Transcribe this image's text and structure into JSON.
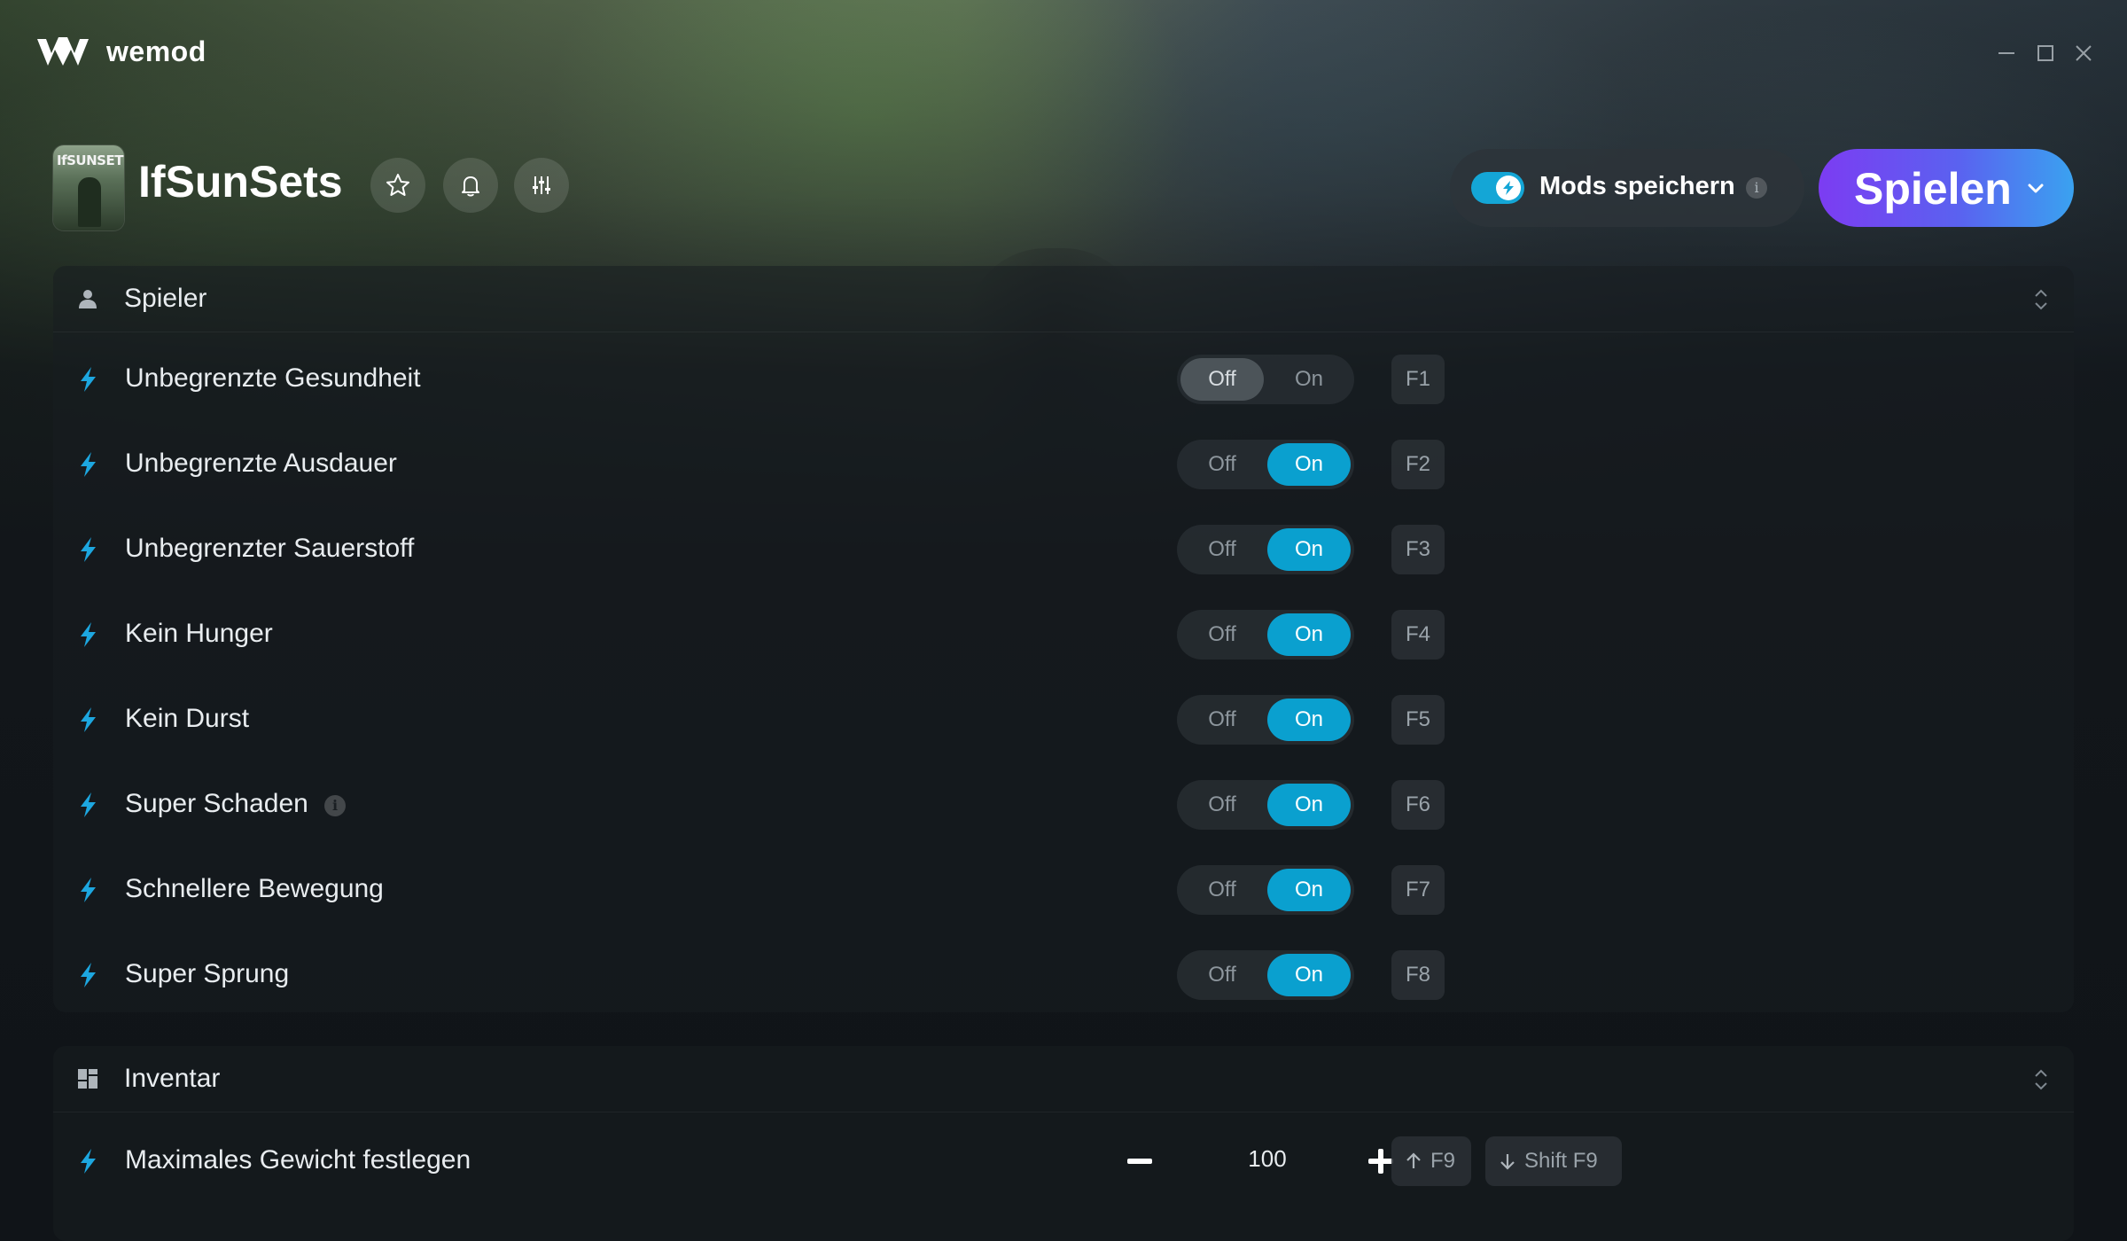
{
  "app": {
    "brand": "wemod"
  },
  "game": {
    "title": "IfSunSets",
    "thumb_text": "IfSUNSETS"
  },
  "header": {
    "mods_save_label": "Mods speichern",
    "mods_save_enabled": true,
    "info_glyph": "i",
    "play_label": "Spielen"
  },
  "sections": {
    "player": {
      "title": "Spieler",
      "icon": "person-icon",
      "mods": [
        {
          "label": "Unbegrenzte Gesundheit",
          "state": "off",
          "off_label": "Off",
          "on_label": "On",
          "hotkey": "F1"
        },
        {
          "label": "Unbegrenzte Ausdauer",
          "state": "on",
          "off_label": "Off",
          "on_label": "On",
          "hotkey": "F2"
        },
        {
          "label": "Unbegrenzter Sauerstoff",
          "state": "on",
          "off_label": "Off",
          "on_label": "On",
          "hotkey": "F3"
        },
        {
          "label": "Kein Hunger",
          "state": "on",
          "off_label": "Off",
          "on_label": "On",
          "hotkey": "F4"
        },
        {
          "label": "Kein Durst",
          "state": "on",
          "off_label": "Off",
          "on_label": "On",
          "hotkey": "F5"
        },
        {
          "label": "Super Schaden",
          "state": "on",
          "off_label": "Off",
          "on_label": "On",
          "hotkey": "F6",
          "has_info": true
        },
        {
          "label": "Schnellere Bewegung",
          "state": "on",
          "off_label": "Off",
          "on_label": "On",
          "hotkey": "F7"
        },
        {
          "label": "Super Sprung",
          "state": "on",
          "off_label": "Off",
          "on_label": "On",
          "hotkey": "F8"
        }
      ]
    },
    "inventory": {
      "title": "Inventar",
      "icon": "grid-icon",
      "mods": [
        {
          "label": "Maximales Gewicht festlegen",
          "value": "100",
          "hotkey_up": "F9",
          "hotkey_down": "Shift F9"
        }
      ]
    }
  },
  "colors": {
    "accent": "#0aa0cf",
    "play_start": "#7c3cf2",
    "play_end": "#3aa2f0"
  }
}
